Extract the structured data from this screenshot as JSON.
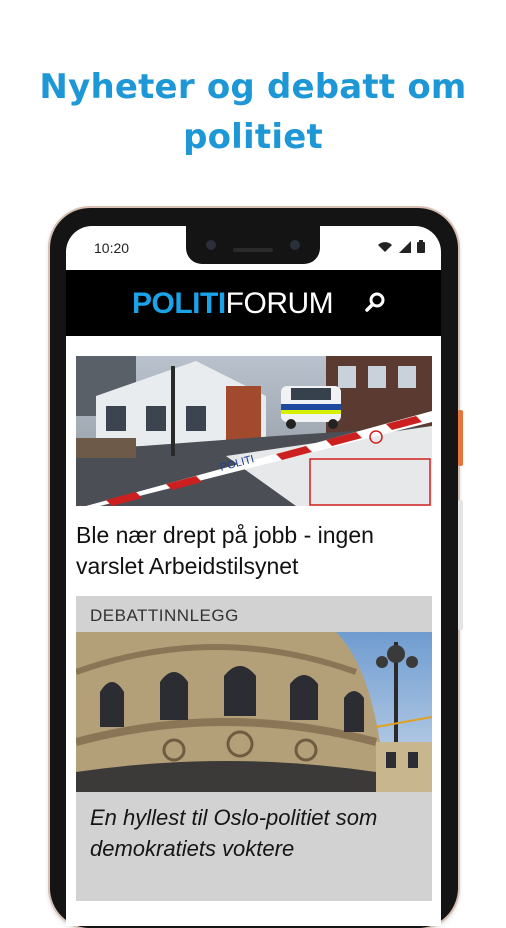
{
  "promo": {
    "line1": "Nyheter og debatt om",
    "line2": "politiet"
  },
  "status_bar": {
    "time": "10:20"
  },
  "app_bar": {
    "logo_bold": "POLITI",
    "logo_light": "FORUM"
  },
  "feed": {
    "article1": {
      "title": "Ble nær drept på jobb - ingen varslet Arbeidstilsynet",
      "tape_text": "POLITI"
    },
    "article2": {
      "category": "DEBATTINNLEGG",
      "title": "En hyllest til Oslo-politiet som demokratiets voktere"
    }
  },
  "colors": {
    "brand_blue": "#1d97d5",
    "app_bar_bg": "#000000",
    "card_bg": "#d2d2d2"
  },
  "icons": {
    "search": "search-icon",
    "wifi": "wifi-icon",
    "signal": "signal-icon",
    "battery": "battery-icon"
  }
}
